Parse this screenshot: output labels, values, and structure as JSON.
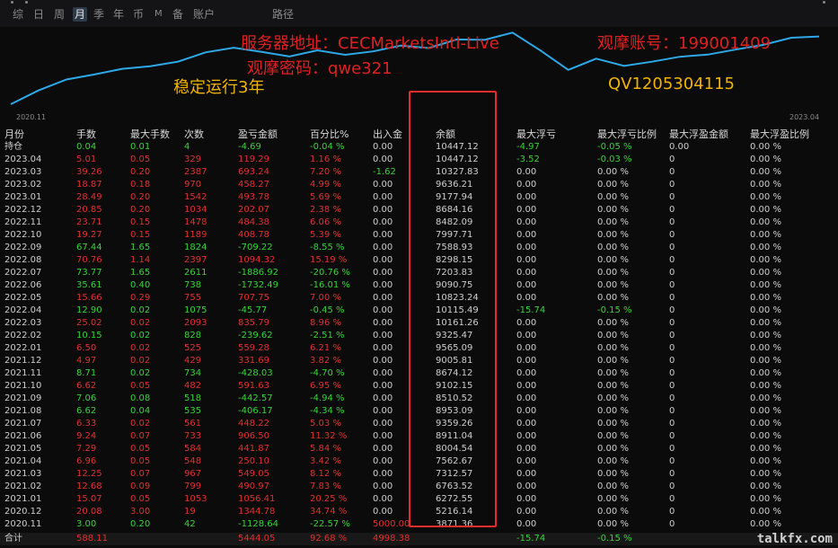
{
  "toolbar": {
    "buttons": [
      "综",
      "日",
      "周",
      "月",
      "季",
      "年",
      "币",
      "M",
      "备",
      "账户"
    ],
    "path_label": "路径"
  },
  "chart": {
    "x_start": "2020.11",
    "x_end": "2023.04",
    "line_color": "#2ea9e8",
    "balances": [
      3871.36,
      5216.14,
      6272.55,
      6763.52,
      7312.57,
      7562.67,
      8004.54,
      8911.04,
      9359.26,
      8953.09,
      8510.52,
      9102.15,
      8674.12,
      9005.81,
      9565.09,
      9325.47,
      10161.26,
      10115.49,
      10823.24,
      9090.75,
      7203.83,
      8298.15,
      7588.93,
      7997.71,
      8482.09,
      8684.16,
      9177.94,
      9636.21,
      10327.83,
      10447.12
    ]
  },
  "overlay": {
    "server": "服务器地址：CECMarketsIntl-Live",
    "account": "观摩账号：199001409",
    "password": "观摩密码：qwe321",
    "stable": "稳定运行3年",
    "qv": "QV1205304115"
  },
  "columns": [
    "月份",
    "手数",
    "最大手数",
    "次数",
    "盈亏金额",
    "百分比%",
    "出入金",
    "余额",
    "最大浮亏",
    "最大浮亏比例",
    "最大浮盈金额",
    "最大浮盈比例"
  ],
  "rows": [
    {
      "m": "持仓",
      "l": "0.04",
      "ml": "0.01",
      "n": "4",
      "p": "-4.69",
      "pct": "-0.04 %",
      "io": "0.00",
      "bal": "10447.12",
      "fl": "-4.97",
      "flp": "-0.05 %",
      "fp": "0.00",
      "fpp": "0.00 %"
    },
    {
      "m": "2023.04",
      "l": "5.01",
      "ml": "0.05",
      "n": "329",
      "p": "119.29",
      "pct": "1.16 %",
      "io": "0.00",
      "bal": "10447.12",
      "fl": "-3.52",
      "flp": "-0.03 %",
      "fp": "0",
      "fpp": "0.00 %"
    },
    {
      "m": "2023.03",
      "l": "39.26",
      "ml": "0.20",
      "n": "2387",
      "p": "693.24",
      "pct": "7.20 %",
      "io": "-1.62",
      "bal": "10327.83",
      "fl": "0.00",
      "flp": "0.00 %",
      "fp": "0",
      "fpp": "0.00 %"
    },
    {
      "m": "2023.02",
      "l": "18.87",
      "ml": "0.18",
      "n": "970",
      "p": "458.27",
      "pct": "4.99 %",
      "io": "0.00",
      "bal": "9636.21",
      "fl": "0.00",
      "flp": "0.00 %",
      "fp": "0",
      "fpp": "0.00 %"
    },
    {
      "m": "2023.01",
      "l": "28.49",
      "ml": "0.20",
      "n": "1542",
      "p": "493.78",
      "pct": "5.69 %",
      "io": "0.00",
      "bal": "9177.94",
      "fl": "0.00",
      "flp": "0.00 %",
      "fp": "0",
      "fpp": "0.00 %"
    },
    {
      "m": "2022.12",
      "l": "20.85",
      "ml": "0.20",
      "n": "1034",
      "p": "202.07",
      "pct": "2.38 %",
      "io": "0.00",
      "bal": "8684.16",
      "fl": "0.00",
      "flp": "0.00 %",
      "fp": "0",
      "fpp": "0.00 %"
    },
    {
      "m": "2022.11",
      "l": "23.71",
      "ml": "0.15",
      "n": "1478",
      "p": "484.38",
      "pct": "6.06 %",
      "io": "0.00",
      "bal": "8482.09",
      "fl": "0.00",
      "flp": "0.00 %",
      "fp": "0",
      "fpp": "0.00 %"
    },
    {
      "m": "2022.10",
      "l": "19.27",
      "ml": "0.15",
      "n": "1189",
      "p": "408.78",
      "pct": "5.39 %",
      "io": "0.00",
      "bal": "7997.71",
      "fl": "0.00",
      "flp": "0.00 %",
      "fp": "0",
      "fpp": "0.00 %"
    },
    {
      "m": "2022.09",
      "l": "67.44",
      "ml": "1.65",
      "n": "1824",
      "p": "-709.22",
      "pct": "-8.55 %",
      "io": "0.00",
      "bal": "7588.93",
      "fl": "0.00",
      "flp": "0.00 %",
      "fp": "0",
      "fpp": "0.00 %"
    },
    {
      "m": "2022.08",
      "l": "70.76",
      "ml": "1.14",
      "n": "2397",
      "p": "1094.32",
      "pct": "15.19 %",
      "io": "0.00",
      "bal": "8298.15",
      "fl": "0.00",
      "flp": "0.00 %",
      "fp": "0",
      "fpp": "0.00 %"
    },
    {
      "m": "2022.07",
      "l": "73.77",
      "ml": "1.65",
      "n": "2611",
      "p": "-1886.92",
      "pct": "-20.76 %",
      "io": "0.00",
      "bal": "7203.83",
      "fl": "0.00",
      "flp": "0.00 %",
      "fp": "0",
      "fpp": "0.00 %"
    },
    {
      "m": "2022.06",
      "l": "35.61",
      "ml": "0.40",
      "n": "738",
      "p": "-1732.49",
      "pct": "-16.01 %",
      "io": "0.00",
      "bal": "9090.75",
      "fl": "0.00",
      "flp": "0.00 %",
      "fp": "0",
      "fpp": "0.00 %"
    },
    {
      "m": "2022.05",
      "l": "15.66",
      "ml": "0.29",
      "n": "755",
      "p": "707.75",
      "pct": "7.00 %",
      "io": "0.00",
      "bal": "10823.24",
      "fl": "0.00",
      "flp": "0.00 %",
      "fp": "0",
      "fpp": "0.00 %"
    },
    {
      "m": "2022.04",
      "l": "12.90",
      "ml": "0.02",
      "n": "1075",
      "p": "-45.77",
      "pct": "-0.45 %",
      "io": "0.00",
      "bal": "10115.49",
      "fl": "-15.74",
      "flp": "-0.15 %",
      "fp": "0",
      "fpp": "0.00 %"
    },
    {
      "m": "2022.03",
      "l": "25.02",
      "ml": "0.02",
      "n": "2093",
      "p": "835.79",
      "pct": "8.96 %",
      "io": "0.00",
      "bal": "10161.26",
      "fl": "0.00",
      "flp": "0.00 %",
      "fp": "0",
      "fpp": "0.00 %"
    },
    {
      "m": "2022.02",
      "l": "10.15",
      "ml": "0.02",
      "n": "828",
      "p": "-239.62",
      "pct": "-2.51 %",
      "io": "0.00",
      "bal": "9325.47",
      "fl": "0.00",
      "flp": "0.00 %",
      "fp": "0",
      "fpp": "0.00 %"
    },
    {
      "m": "2022.01",
      "l": "6.50",
      "ml": "0.02",
      "n": "525",
      "p": "559.28",
      "pct": "6.21 %",
      "io": "0.00",
      "bal": "9565.09",
      "fl": "0.00",
      "flp": "0.00 %",
      "fp": "0",
      "fpp": "0.00 %"
    },
    {
      "m": "2021.12",
      "l": "4.97",
      "ml": "0.02",
      "n": "429",
      "p": "331.69",
      "pct": "3.82 %",
      "io": "0.00",
      "bal": "9005.81",
      "fl": "0.00",
      "flp": "0.00 %",
      "fp": "0",
      "fpp": "0.00 %"
    },
    {
      "m": "2021.11",
      "l": "8.71",
      "ml": "0.02",
      "n": "734",
      "p": "-428.03",
      "pct": "-4.70 %",
      "io": "0.00",
      "bal": "8674.12",
      "fl": "0.00",
      "flp": "0.00 %",
      "fp": "0",
      "fpp": "0.00 %"
    },
    {
      "m": "2021.10",
      "l": "6.62",
      "ml": "0.05",
      "n": "482",
      "p": "591.63",
      "pct": "6.95 %",
      "io": "0.00",
      "bal": "9102.15",
      "fl": "0.00",
      "flp": "0.00 %",
      "fp": "0",
      "fpp": "0.00 %"
    },
    {
      "m": "2021.09",
      "l": "7.06",
      "ml": "0.08",
      "n": "518",
      "p": "-442.57",
      "pct": "-4.94 %",
      "io": "0.00",
      "bal": "8510.52",
      "fl": "0.00",
      "flp": "0.00 %",
      "fp": "0",
      "fpp": "0.00 %"
    },
    {
      "m": "2021.08",
      "l": "6.62",
      "ml": "0.04",
      "n": "535",
      "p": "-406.17",
      "pct": "-4.34 %",
      "io": "0.00",
      "bal": "8953.09",
      "fl": "0.00",
      "flp": "0.00 %",
      "fp": "0",
      "fpp": "0.00 %"
    },
    {
      "m": "2021.07",
      "l": "6.33",
      "ml": "0.02",
      "n": "561",
      "p": "448.22",
      "pct": "5.03 %",
      "io": "0.00",
      "bal": "9359.26",
      "fl": "0.00",
      "flp": "0.00 %",
      "fp": "0",
      "fpp": "0.00 %"
    },
    {
      "m": "2021.06",
      "l": "9.24",
      "ml": "0.07",
      "n": "733",
      "p": "906.50",
      "pct": "11.32 %",
      "io": "0.00",
      "bal": "8911.04",
      "fl": "0.00",
      "flp": "0.00 %",
      "fp": "0",
      "fpp": "0.00 %"
    },
    {
      "m": "2021.05",
      "l": "7.29",
      "ml": "0.05",
      "n": "584",
      "p": "441.87",
      "pct": "5.84 %",
      "io": "0.00",
      "bal": "8004.54",
      "fl": "0.00",
      "flp": "0.00 %",
      "fp": "0",
      "fpp": "0.00 %"
    },
    {
      "m": "2021.04",
      "l": "6.96",
      "ml": "0.05",
      "n": "548",
      "p": "250.10",
      "pct": "3.42 %",
      "io": "0.00",
      "bal": "7562.67",
      "fl": "0.00",
      "flp": "0.00 %",
      "fp": "0",
      "fpp": "0.00 %"
    },
    {
      "m": "2021.03",
      "l": "12.25",
      "ml": "0.07",
      "n": "967",
      "p": "549.05",
      "pct": "8.12 %",
      "io": "0.00",
      "bal": "7312.57",
      "fl": "0.00",
      "flp": "0.00 %",
      "fp": "0",
      "fpp": "0.00 %"
    },
    {
      "m": "2021.02",
      "l": "12.68",
      "ml": "0.09",
      "n": "799",
      "p": "490.97",
      "pct": "7.83 %",
      "io": "0.00",
      "bal": "6763.52",
      "fl": "0.00",
      "flp": "0.00 %",
      "fp": "0",
      "fpp": "0.00 %"
    },
    {
      "m": "2021.01",
      "l": "15.07",
      "ml": "0.05",
      "n": "1053",
      "p": "1056.41",
      "pct": "20.25 %",
      "io": "0.00",
      "bal": "6272.55",
      "fl": "0.00",
      "flp": "0.00 %",
      "fp": "0",
      "fpp": "0.00 %"
    },
    {
      "m": "2020.12",
      "l": "20.08",
      "ml": "3.00",
      "n": "19",
      "p": "1344.78",
      "pct": "34.74 %",
      "io": "0.00",
      "bal": "5216.14",
      "fl": "0.00",
      "flp": "0.00 %",
      "fp": "0",
      "fpp": "0.00 %"
    },
    {
      "m": "2020.11",
      "l": "3.00",
      "ml": "0.20",
      "n": "42",
      "p": "-1128.64",
      "pct": "-22.57 %",
      "io": "5000.00",
      "bal": "3871.36",
      "fl": "0.00",
      "flp": "0.00 %",
      "fp": "0",
      "fpp": "0.00 %"
    }
  ],
  "total": {
    "m": "合计",
    "l": "588.11",
    "ml": "",
    "n": "",
    "p": "5444.05",
    "pct": "92.68 %",
    "io": "4998.38",
    "bal": "",
    "fl": "-15.74",
    "flp": "-0.15 %",
    "fp": "",
    "fpp": ""
  },
  "watermark": "talkfx.com",
  "colors": {
    "positive": "#35d435",
    "negative": "#e03030",
    "neutral": "#cfcfcf",
    "highlight": "#e52b2b"
  }
}
